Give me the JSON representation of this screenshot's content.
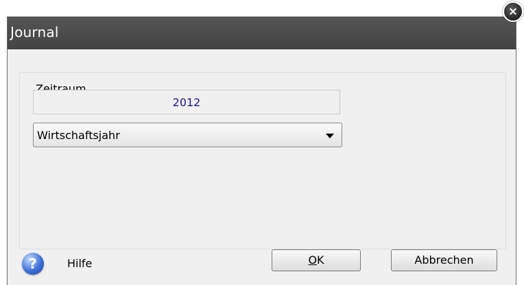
{
  "window": {
    "title": "Journal",
    "close_symbol": "×"
  },
  "group": {
    "label": "Zeitraum",
    "year_value": "2012",
    "period_select": {
      "selected": "Wirtschaftsjahr"
    }
  },
  "footer": {
    "help_symbol": "?",
    "help_label": "Hilfe",
    "ok_accesskey": "O",
    "ok_rest": "K",
    "cancel_label": "Abbrechen"
  },
  "icons": {
    "close": "close-icon",
    "help": "help-icon",
    "dropdown": "chevron-down-icon"
  },
  "colors": {
    "titlebar": "#4a4a4a",
    "dialog_bg": "#f0f0f0",
    "year_text": "#1b1b8a",
    "help_blue": "#3c6fd6"
  }
}
